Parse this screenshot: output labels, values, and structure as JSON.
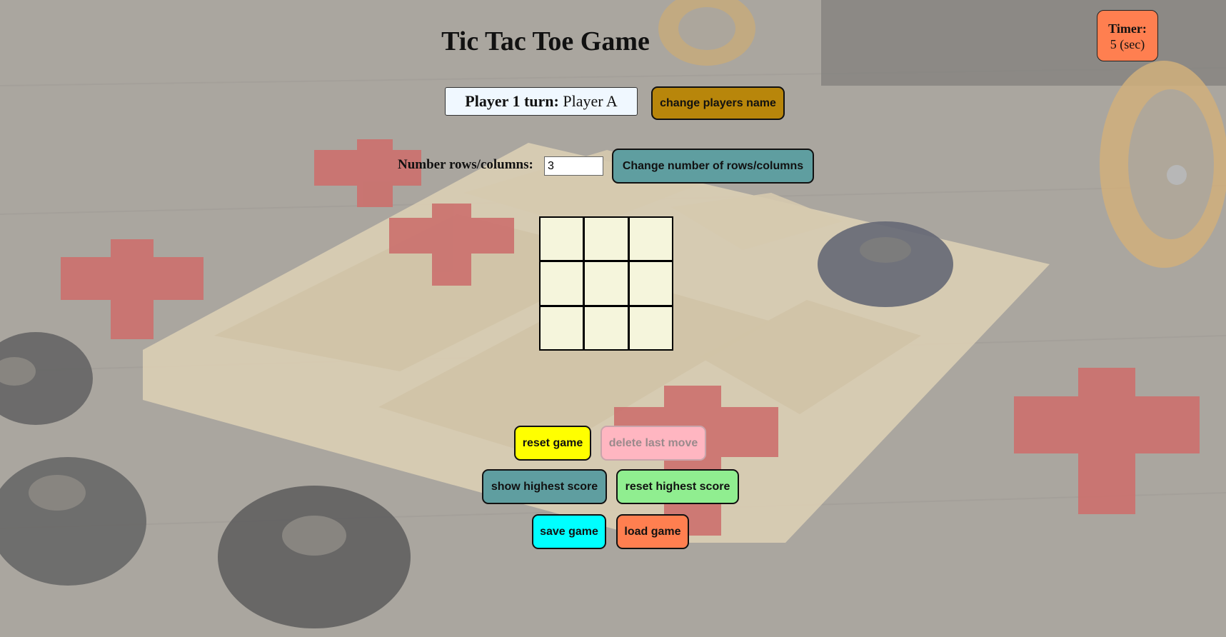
{
  "title": "Tic Tac Toe Game",
  "timer": {
    "label": "Timer:",
    "value": "5 (sec)",
    "color": "#ff7f50"
  },
  "turn": {
    "label": "Player 1 turn:",
    "player": "Player A"
  },
  "buttons": {
    "change_players_name": "change players name",
    "change_rows": "Change number of rows/columns",
    "reset_game": "reset game",
    "delete_last_move": "delete last move",
    "show_highest_score": "show highest score",
    "reset_highest_score": "reset highest score",
    "save_game": "save game",
    "load_game": "load game"
  },
  "rows_columns": {
    "label": "Number rows/columns:",
    "value": "3"
  },
  "board": {
    "size": 3,
    "cells": [
      "",
      "",
      "",
      "",
      "",
      "",
      "",
      "",
      ""
    ]
  },
  "colors": {
    "change_players_name": "#b8860b",
    "change_rows": "#5f9ea0",
    "reset_game": "#ffff00",
    "delete_last_move": "#ffb6c1",
    "show_highest_score": "#5f9ea0",
    "reset_highest_score": "#90ee90",
    "save_game": "#00ffff",
    "load_game": "#ff7f50",
    "cell": "#f5f5dc"
  }
}
